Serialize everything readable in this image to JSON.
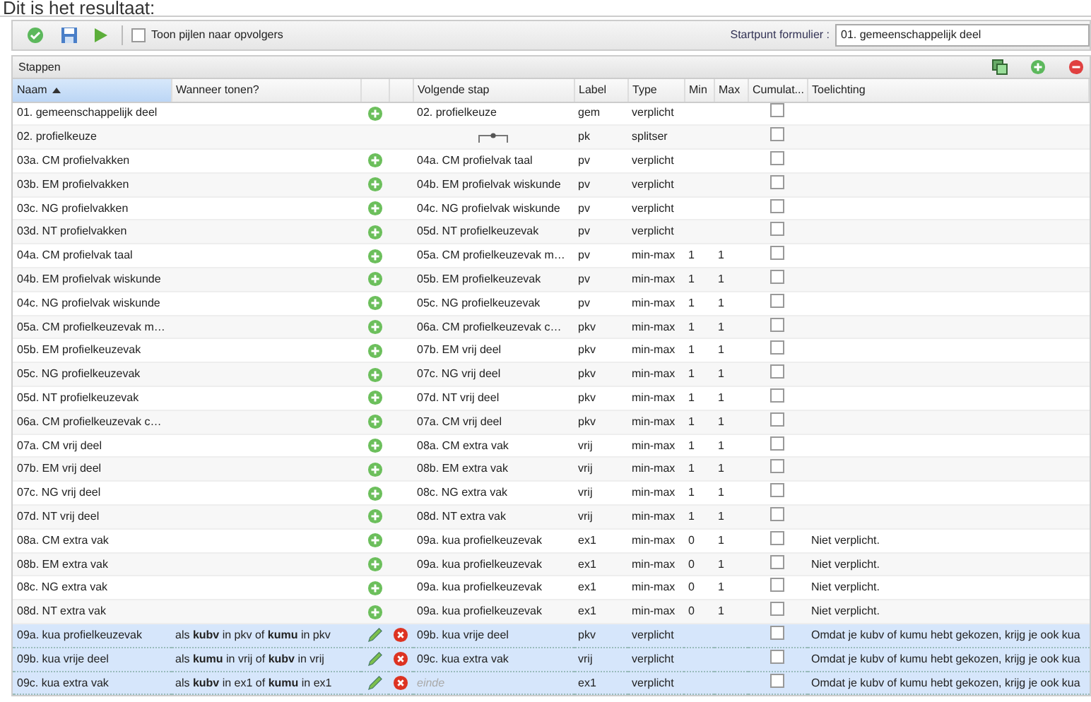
{
  "heading": "Dit is het resultaat:",
  "toolbar": {
    "show_arrows": {
      "label": "Toon pijlen naar opvolgers",
      "checked": false
    },
    "start_label": "Startpunt formulier :",
    "start_value": "01. gemeenschappelijk deel"
  },
  "panel": {
    "title": "Stappen"
  },
  "columns": [
    {
      "label": "Naam",
      "sorted": true
    },
    {
      "label": "Wanneer tonen?",
      "sorted": false
    },
    {
      "sorted": false
    },
    {
      "sorted": false
    },
    {
      "label": "Volgende stap",
      "sorted": false
    },
    {
      "label": "Label",
      "sorted": false
    },
    {
      "label": "Type",
      "sorted": false
    },
    {
      "label": "Min",
      "sorted": false
    },
    {
      "label": "Max",
      "sorted": false
    },
    {
      "label": "Cumulat...",
      "sorted": false
    },
    {
      "label": "Toelichting",
      "sorted": false
    }
  ],
  "rows": [
    {
      "name": "01. gemeenschappelijk deel",
      "kind": "add",
      "next": "02. profielkeuze",
      "label": "gem",
      "type": "verplicht",
      "cumulative": false,
      "selected": false
    },
    {
      "name": "02. profielkeuze",
      "kind": "splitter",
      "label": "pk",
      "type": "splitser",
      "cumulative": false,
      "selected": false
    },
    {
      "name": "03a. CM profielvakken",
      "kind": "add",
      "next": "04a. CM profielvak taal",
      "label": "pv",
      "type": "verplicht",
      "cumulative": false,
      "selected": false
    },
    {
      "name": "03b. EM profielvakken",
      "kind": "add",
      "next": "04b. EM profielvak wiskunde",
      "label": "pv",
      "type": "verplicht",
      "cumulative": false,
      "selected": false
    },
    {
      "name": "03c. NG profielvakken",
      "kind": "add",
      "next": "04c. NG profielvak wiskunde",
      "label": "pv",
      "type": "verplicht",
      "cumulative": false,
      "selected": false
    },
    {
      "name": "03d. NT profielvakken",
      "kind": "add",
      "next": "05d. NT profielkeuzevak",
      "label": "pv",
      "type": "verplicht",
      "cumulative": false,
      "selected": false
    },
    {
      "name": "04a. CM profielvak taal",
      "kind": "add",
      "next": "05a. CM profielkeuzevak m…",
      "label": "pv",
      "type": "min-max",
      "min": "1",
      "max": "1",
      "cumulative": false,
      "selected": false
    },
    {
      "name": "04b. EM profielvak wiskunde",
      "kind": "add",
      "next": "05b. EM profielkeuzevak",
      "label": "pv",
      "type": "min-max",
      "min": "1",
      "max": "1",
      "cumulative": false,
      "selected": false
    },
    {
      "name": "04c. NG profielvak wiskunde",
      "kind": "add",
      "next": "05c. NG profielkeuzevak",
      "label": "pv",
      "type": "min-max",
      "min": "1",
      "max": "1",
      "cumulative": false,
      "selected": false
    },
    {
      "name": "05a. CM profielkeuzevak m…",
      "kind": "add",
      "next": "06a. CM profielkeuzevak c…",
      "label": "pkv",
      "type": "min-max",
      "min": "1",
      "max": "1",
      "cumulative": false,
      "selected": false
    },
    {
      "name": "05b. EM profielkeuzevak",
      "kind": "add",
      "next": "07b. EM vrij deel",
      "label": "pkv",
      "type": "min-max",
      "min": "1",
      "max": "1",
      "cumulative": false,
      "selected": false
    },
    {
      "name": "05c. NG profielkeuzevak",
      "kind": "add",
      "next": "07c. NG vrij deel",
      "label": "pkv",
      "type": "min-max",
      "min": "1",
      "max": "1",
      "cumulative": false,
      "selected": false
    },
    {
      "name": "05d. NT profielkeuzevak",
      "kind": "add",
      "next": "07d. NT vrij deel",
      "label": "pkv",
      "type": "min-max",
      "min": "1",
      "max": "1",
      "cumulative": false,
      "selected": false
    },
    {
      "name": "06a. CM profielkeuzevak c…",
      "kind": "add",
      "next": "07a. CM vrij deel",
      "label": "pkv",
      "type": "min-max",
      "min": "1",
      "max": "1",
      "cumulative": false,
      "selected": false
    },
    {
      "name": "07a. CM vrij deel",
      "kind": "add",
      "next": "08a. CM extra vak",
      "label": "vrij",
      "type": "min-max",
      "min": "1",
      "max": "1",
      "cumulative": false,
      "selected": false
    },
    {
      "name": "07b. EM vrij deel",
      "kind": "add",
      "next": "08b. EM extra vak",
      "label": "vrij",
      "type": "min-max",
      "min": "1",
      "max": "1",
      "cumulative": false,
      "selected": false
    },
    {
      "name": "07c. NG vrij deel",
      "kind": "add",
      "next": "08c. NG extra vak",
      "label": "vrij",
      "type": "min-max",
      "min": "1",
      "max": "1",
      "cumulative": false,
      "selected": false
    },
    {
      "name": "07d. NT vrij deel",
      "kind": "add",
      "next": "08d. NT extra vak",
      "label": "vrij",
      "type": "min-max",
      "min": "1",
      "max": "1",
      "cumulative": false,
      "selected": false
    },
    {
      "name": "08a. CM extra vak",
      "kind": "add",
      "next": "09a. kua profielkeuzevak",
      "label": "ex1",
      "type": "min-max",
      "min": "0",
      "max": "1",
      "cumulative": false,
      "note": "Niet verplicht.",
      "selected": false
    },
    {
      "name": "08b. EM extra vak",
      "kind": "add",
      "next": "09a. kua profielkeuzevak",
      "label": "ex1",
      "type": "min-max",
      "min": "0",
      "max": "1",
      "cumulative": false,
      "note": "Niet verplicht.",
      "selected": false
    },
    {
      "name": "08c. NG extra vak",
      "kind": "add",
      "next": "09a. kua profielkeuzevak",
      "label": "ex1",
      "type": "min-max",
      "min": "0",
      "max": "1",
      "cumulative": false,
      "note": "Niet verplicht.",
      "selected": false
    },
    {
      "name": "08d. NT extra vak",
      "kind": "add",
      "next": "09a. kua profielkeuzevak",
      "label": "ex1",
      "type": "min-max",
      "min": "0",
      "max": "1",
      "cumulative": false,
      "note": "Niet verplicht.",
      "selected": false
    },
    {
      "name": "09a. kua profielkeuzevak",
      "condition": "als **kubv** in pkv of **kumu** in pkv",
      "kind": "edit",
      "next": "09b. kua vrije deel",
      "label": "pkv",
      "type": "verplicht",
      "cumulative": false,
      "note": "Omdat je kubv of kumu hebt gekozen, krijg je ook kua",
      "selected": true
    },
    {
      "name": "09b. kua vrije deel",
      "condition": "als **kumu** in vrij of **kubv** in vrij",
      "kind": "edit",
      "next": "09c. kua extra vak",
      "label": "vrij",
      "type": "verplicht",
      "cumulative": false,
      "note": "Omdat je kubv of kumu hebt gekozen, krijg je ook kua",
      "selected": true
    },
    {
      "name": "09c. kua extra vak",
      "condition": "als **kubv** in ex1 of **kumu** in ex1",
      "kind": "edit",
      "next": "einde",
      "next_is_end": true,
      "label": "ex1",
      "type": "verplicht",
      "cumulative": false,
      "note": "Omdat je kubv of kumu hebt gekozen, krijg je ook kua",
      "selected": true
    }
  ]
}
